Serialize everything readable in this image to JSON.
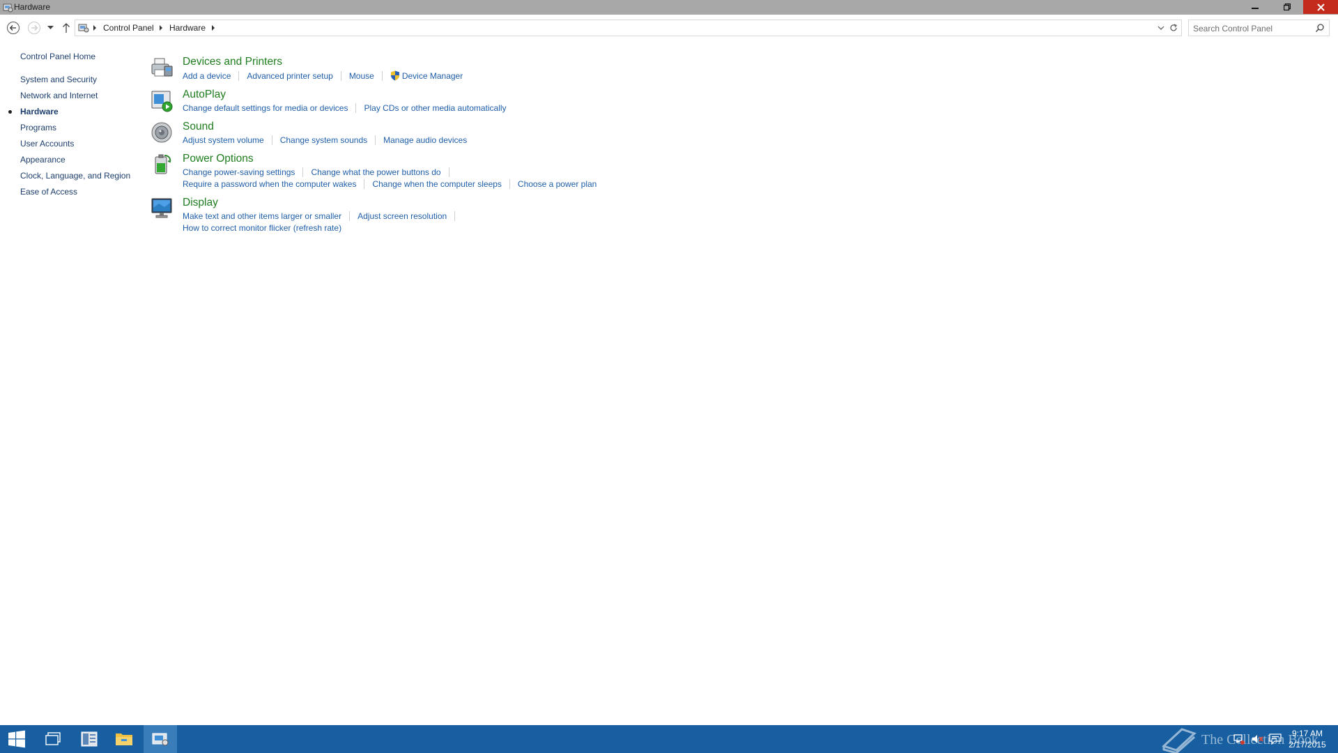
{
  "window": {
    "title": "Hardware"
  },
  "address": {
    "crumbs": [
      "Control Panel",
      "Hardware"
    ]
  },
  "search": {
    "placeholder": "Search Control Panel"
  },
  "sidebar": {
    "home": "Control Panel Home",
    "items": [
      {
        "label": "System and Security",
        "current": false
      },
      {
        "label": "Network and Internet",
        "current": false
      },
      {
        "label": "Hardware",
        "current": true
      },
      {
        "label": "Programs",
        "current": false
      },
      {
        "label": "User Accounts",
        "current": false
      },
      {
        "label": "Appearance",
        "current": false
      },
      {
        "label": "Clock, Language, and Region",
        "current": false
      },
      {
        "label": "Ease of Access",
        "current": false
      }
    ]
  },
  "categories": [
    {
      "title": "Devices and Printers",
      "icon": "printer-icon",
      "rows": [
        [
          "Add a device",
          "Advanced printer setup",
          "Mouse",
          "Device Manager"
        ]
      ]
    },
    {
      "title": "AutoPlay",
      "icon": "autoplay-icon",
      "rows": [
        [
          "Change default settings for media or devices",
          "Play CDs or other media automatically"
        ]
      ]
    },
    {
      "title": "Sound",
      "icon": "speaker-icon",
      "rows": [
        [
          "Adjust system volume",
          "Change system sounds",
          "Manage audio devices"
        ]
      ]
    },
    {
      "title": "Power Options",
      "icon": "battery-icon",
      "rows": [
        [
          "Change power-saving settings",
          "Change what the power buttons do"
        ],
        [
          "Require a password when the computer wakes",
          "Change when the computer sleeps",
          "Choose a power plan"
        ]
      ]
    },
    {
      "title": "Display",
      "icon": "monitor-icon",
      "rows": [
        [
          "Make text and other items larger or smaller",
          "Adjust screen resolution"
        ],
        [
          "How to correct monitor flicker (refresh rate)"
        ]
      ]
    }
  ],
  "taskbar": {
    "watermark": "The Collection Book",
    "time": "9:17 AM",
    "date": "2/17/2015"
  },
  "colors": {
    "titlebar": "#a8a8a8",
    "taskbar": "#175fa0",
    "link": "#1f5ea8",
    "category_title": "#1e7d1e",
    "close_button": "#c42b1c"
  }
}
